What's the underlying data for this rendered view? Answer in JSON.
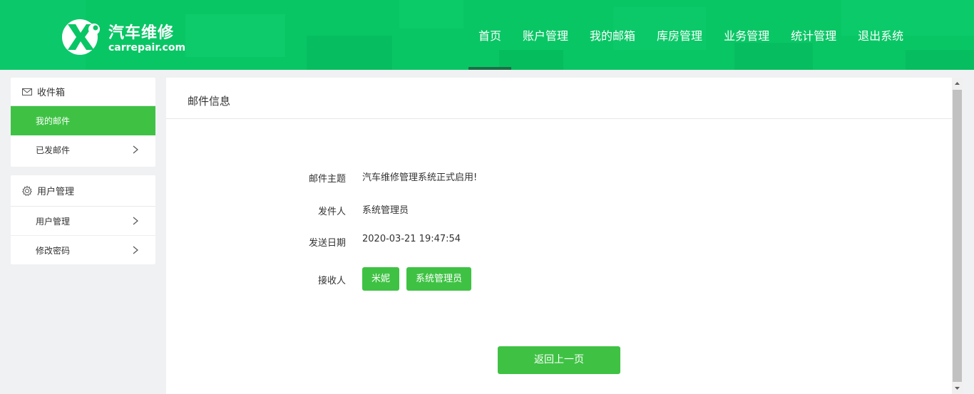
{
  "brand": {
    "title": "汽车维修",
    "domain": "carrepair.com",
    "color": "#09c665"
  },
  "nav": {
    "items": [
      {
        "label": "首页",
        "active": true
      },
      {
        "label": "账户管理"
      },
      {
        "label": "我的邮箱"
      },
      {
        "label": "库房管理"
      },
      {
        "label": "业务管理"
      },
      {
        "label": "统计管理"
      },
      {
        "label": "退出系统"
      }
    ]
  },
  "sidebar": {
    "inbox": {
      "title": "收件箱",
      "icon": "mail-icon",
      "items": [
        {
          "label": "我的邮件",
          "active": true
        },
        {
          "label": "已发邮件"
        }
      ]
    },
    "users": {
      "title": "用户管理",
      "icon": "gear-icon",
      "items": [
        {
          "label": "用户管理"
        },
        {
          "label": "修改密码"
        }
      ]
    }
  },
  "main": {
    "title": "邮件信息",
    "fields": {
      "subject_label": "邮件主题",
      "subject": "汽车维修管理系统正式启用!",
      "sender_label": "发件人",
      "sender": "系统管理员",
      "date_label": "发送日期",
      "date": "2020-03-21 19:47:54",
      "recipients_label": "接收人",
      "recipients": [
        "米妮",
        "系统管理员"
      ]
    },
    "back_button": "返回上一页"
  },
  "accent_color": "#3fc244"
}
